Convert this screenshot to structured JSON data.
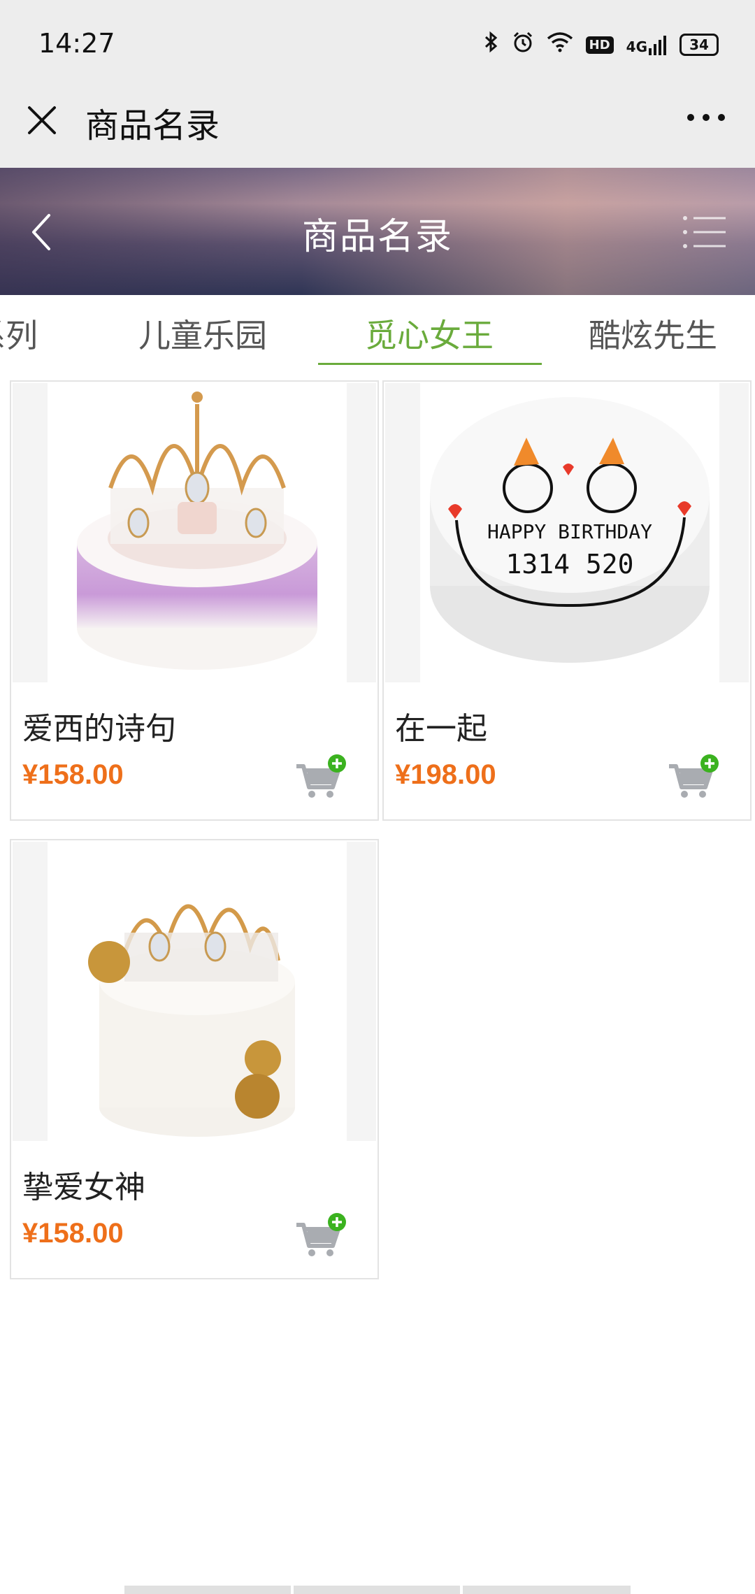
{
  "status_bar": {
    "time": "14:27",
    "hd": "HD",
    "network": "4G",
    "battery": "34",
    "icons": [
      "bluetooth-icon",
      "alarm-icon",
      "wifi-icon",
      "hd-icon",
      "signal-icon",
      "battery-icon"
    ]
  },
  "wechat_header": {
    "title": "商品名录",
    "close_icon": "close-icon",
    "more_icon": "more-icon"
  },
  "banner": {
    "title": "商品名录"
  },
  "tabs": [
    {
      "label": "系列"
    },
    {
      "label": "儿童乐园"
    },
    {
      "label": "觅心女王",
      "active": true
    },
    {
      "label": "酷炫先生"
    }
  ],
  "products": [
    {
      "name": "爱西的诗句",
      "price": "¥158.00"
    },
    {
      "name": "在一起",
      "price": "¥198.00",
      "cake_text_1": "HAPPY BIRTHDAY",
      "cake_text_2": "1314 520"
    },
    {
      "name": "挚爱女神",
      "price": "¥158.00"
    }
  ],
  "colors": {
    "accent": "#6aab3c",
    "price": "#ee6f1a",
    "cart_plus": "#3bb21f"
  }
}
